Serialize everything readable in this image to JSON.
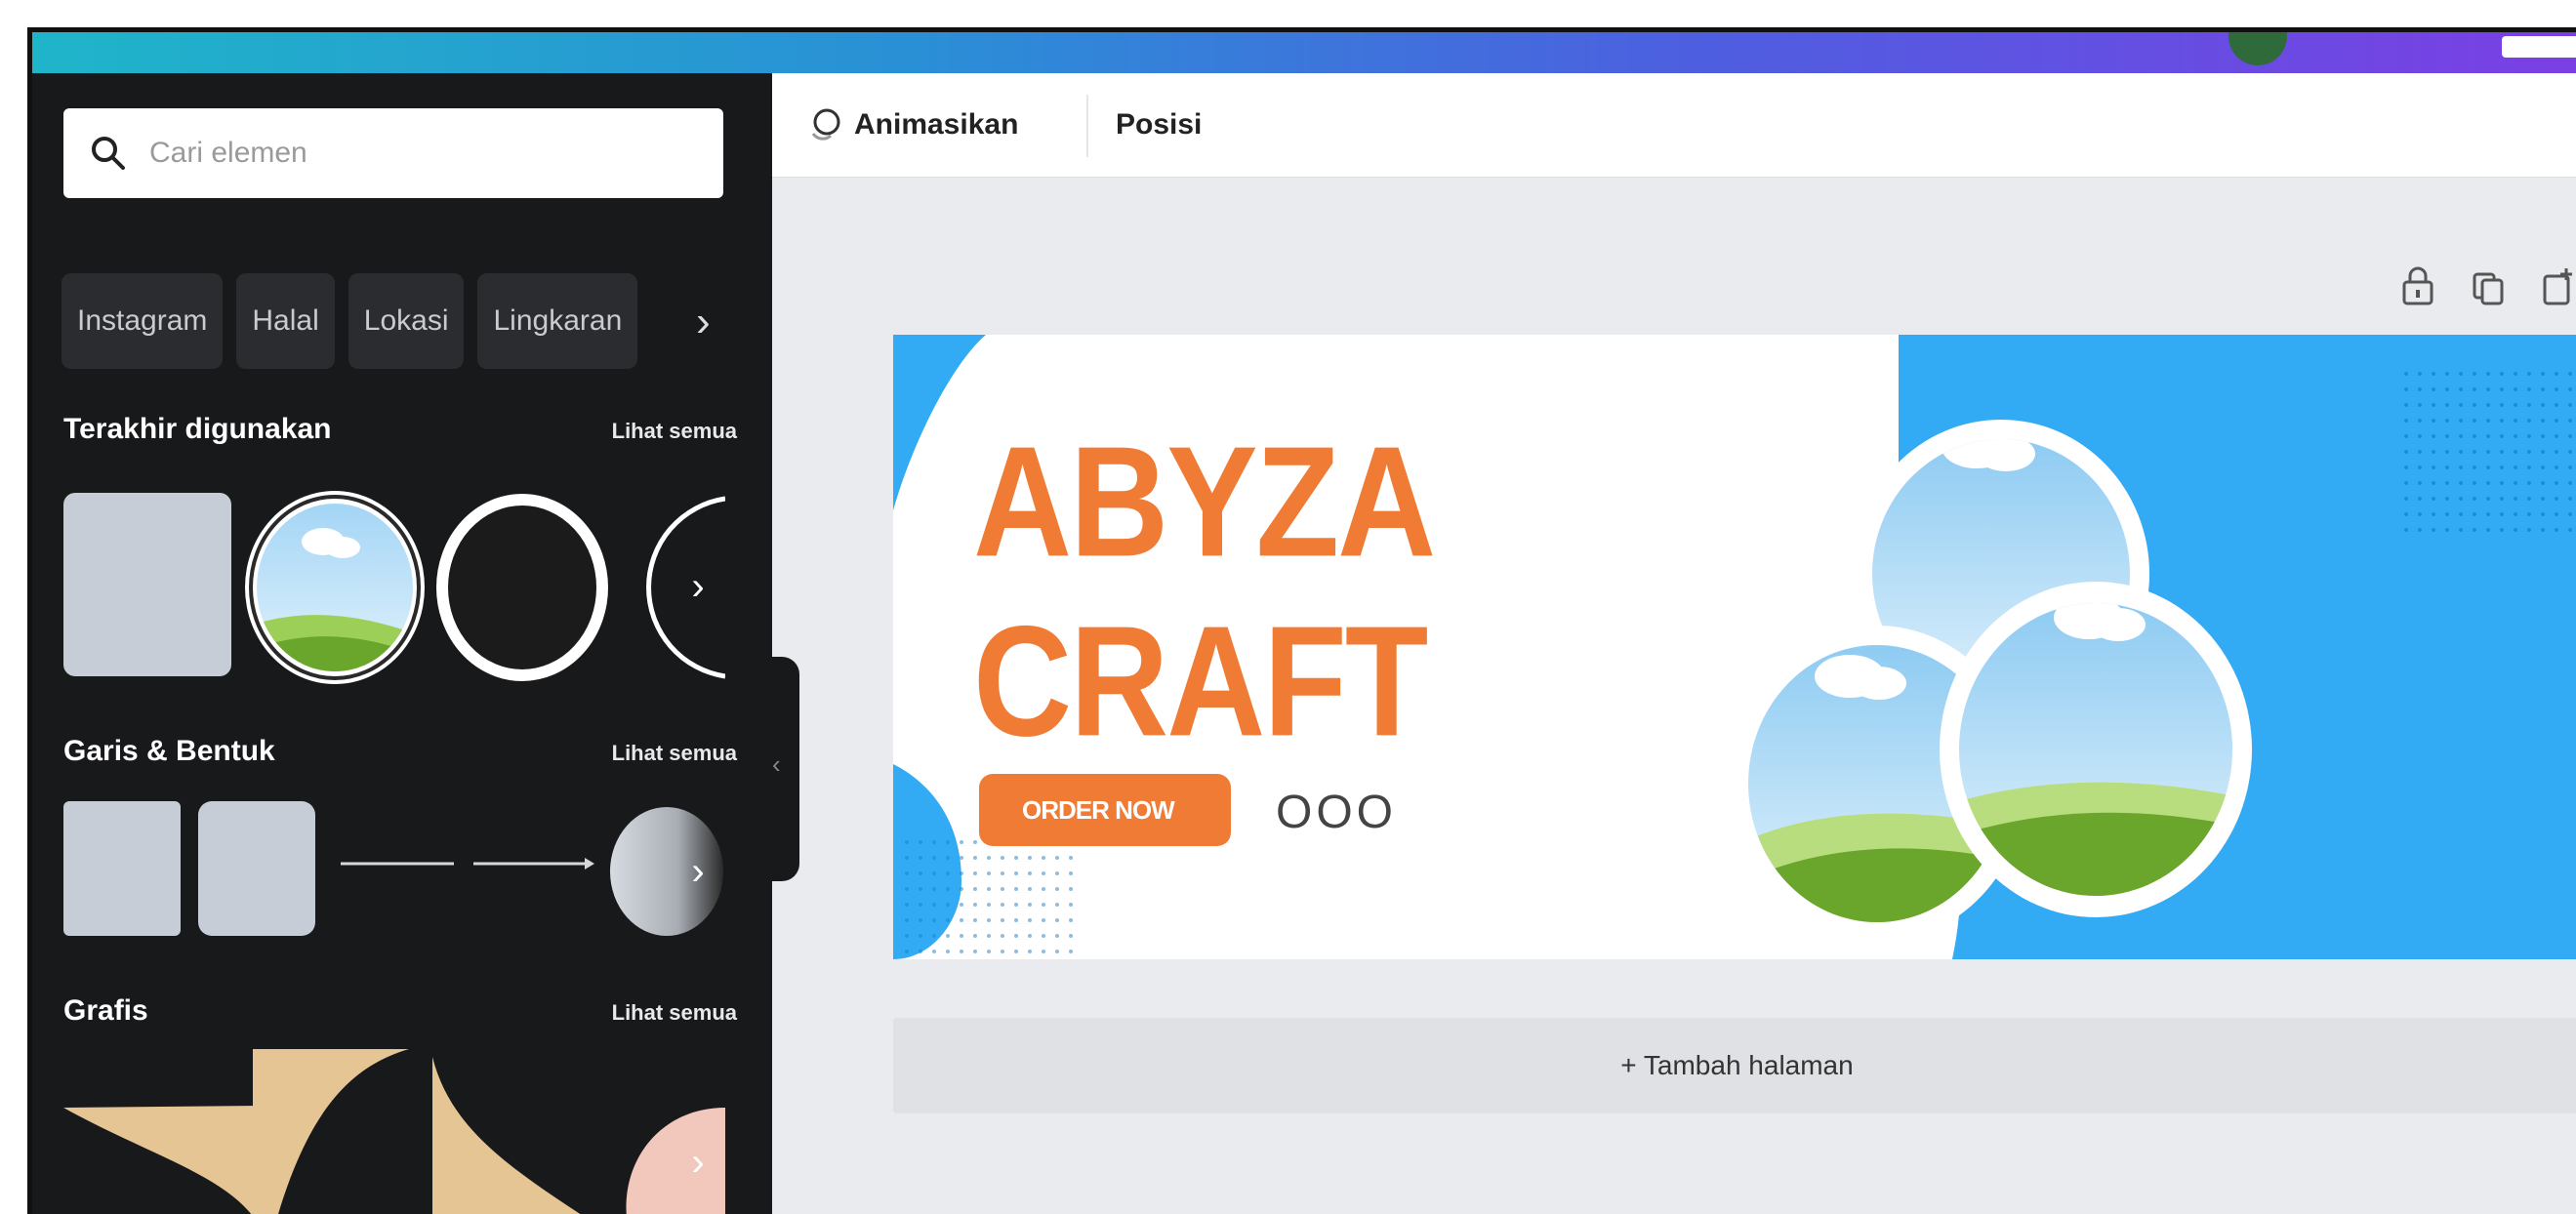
{
  "search": {
    "placeholder": "Cari elemen"
  },
  "chips": [
    "Instagram",
    "Halal",
    "Lokasi",
    "Lingkaran"
  ],
  "sections": [
    {
      "title": "Terakhir digunakan",
      "link": "Lihat semua"
    },
    {
      "title": "Garis & Bentuk",
      "link": "Lihat semua"
    },
    {
      "title": "Grafis",
      "link": "Lihat semua"
    }
  ],
  "toolbar": {
    "animate_label": "Animasikan",
    "position_label": "Posisi"
  },
  "canvas": {
    "line1": "ABYZA",
    "line2": "CRAFT",
    "order_button": "ORDER NOW",
    "dots": "OOO"
  },
  "add_page_label": "+ Tambah halaman",
  "colors": {
    "accent_orange": "#f07b34",
    "sky_blue": "#33aaf4",
    "sidebar": "#18191b"
  }
}
